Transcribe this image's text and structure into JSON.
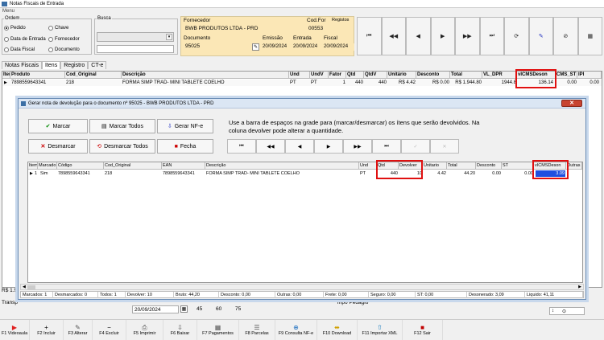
{
  "window": {
    "title": "Notas Fiscais de Entrada"
  },
  "menubar": {
    "label": "Menu"
  },
  "ordem": {
    "legend": "Ordem",
    "opts": [
      "Pedido",
      "Chave",
      "Data de Entrada",
      "Fornecedor",
      "Data Fiscal",
      "Documento"
    ],
    "selected": "Pedido"
  },
  "busca": {
    "legend": "Busca"
  },
  "fornecedor": {
    "label": "Fornecedor",
    "value": "BWB PRODUTOS LTDA - PRD",
    "cod_label": "Cod.For",
    "registros_label": "Registos",
    "cod_value": "00553",
    "doc_label": "Documento",
    "doc_value": "95025",
    "emissao_label": "Emissão",
    "emissao_value": "20/09/2024",
    "entrada_label": "Entrada",
    "entrada_value": "20/09/2024",
    "fiscal_label": "Fiscal",
    "fiscal_value": "20/09/2024"
  },
  "nav": [
    "⏮",
    "◀◀",
    "◀",
    "▶",
    "▶▶",
    "⏭",
    "⟳",
    "✎",
    "⊘",
    "▦"
  ],
  "tabs": [
    "Notas Fiscais",
    "Itens",
    "Registro",
    "CT-e"
  ],
  "main_grid": {
    "headers": [
      "Item",
      "Produto",
      "Cod_Original",
      "Descrição",
      "Und",
      "UndV",
      "Fator",
      "Qtd",
      "QtdV",
      "Unitário",
      "Desconto",
      "Total",
      "VL_DPR",
      "vICMSDeson",
      "CMS_ST",
      "IPI"
    ],
    "row": [
      "1",
      "7898559643341",
      "218",
      "FORMA SIMP TRAD- MINI TABLETE COELHO",
      "PT",
      "PT",
      "1",
      "440",
      "440",
      "R$ 4.42",
      "R$ 0.00",
      "R$ 1.944.80",
      "1944.8",
      "136.14",
      "0.00",
      "0.00"
    ]
  },
  "behind": {
    "rs_left": "R$ 1.9",
    "transp_label": "Transp",
    "date": "20/09/2024",
    "v45": "45",
    "v60": "60",
    "v75": "75",
    "cargo": "mpo Pedagio"
  },
  "dialog": {
    "title": "Gerar nota de devolução para o documento nº 95025 - BWB PRODUTOS LTDA - PRD",
    "btn_marcar": "Marcar",
    "btn_marcar_todos": "Marcar Todos",
    "btn_gerar": "Gerar NF-e",
    "btn_desmarcar": "Desmarcar",
    "btn_desmarcar_todos": "Desmarcar Todos",
    "btn_fecha": "Fecha",
    "hint": "Use a barra de espaços na grade para (marcar/desmarcar) os ítens que serão devolvidos. Na coluna devolver pode alterar a quantidade.",
    "nav": [
      "⏮",
      "◀◀",
      "◀",
      "▶",
      "▶▶",
      "⏭",
      "✓",
      "✕"
    ],
    "grid_headers": [
      "Item",
      "Marcado",
      "Código",
      "Cod_Original",
      "EAN",
      "Descrição",
      "Und",
      "Qtd",
      "Devolver",
      "Unitario",
      "Total",
      "Desconto",
      "ST",
      "vICMSDeson",
      "Outras"
    ],
    "grid_row": [
      "1",
      "Sim",
      "7898559643341",
      "218",
      "7898559643341",
      "FORMA SIMP TRAD- MINI TABLETE COELHO",
      "PT",
      "440",
      "10",
      "4.42",
      "44.20",
      "0.00",
      "0.00",
      "3.09",
      ""
    ],
    "summary": [
      "Marcados: 1",
      "Desmarcados: 0",
      "Todos: 1",
      "Devolver: 10",
      "Bruto: 44,20",
      "Desconto: 0,00",
      "Outras: 0,00",
      "Frete: 0,00",
      "Seguro: 0,00",
      "ST: 0,00",
      "Desonerado: 3,09",
      "Liquido: 41,11"
    ]
  },
  "fkeys": [
    {
      "g": "▶",
      "c": "#e02020",
      "label": "F1 Videoaula"
    },
    {
      "g": "+",
      "c": "#000",
      "label": "F2 Incluir"
    },
    {
      "g": "✎",
      "c": "#555",
      "label": "F3 Alterar"
    },
    {
      "g": "−",
      "c": "#000",
      "label": "F4 Excluir"
    },
    {
      "g": "⎙",
      "c": "#555",
      "label": "F5 Imprimir"
    },
    {
      "g": "⇩",
      "c": "#555",
      "label": "F6 Baixar"
    },
    {
      "g": "▦",
      "c": "#555",
      "label": "F7 Pagamentos"
    },
    {
      "g": "☰",
      "c": "#555",
      "label": "F8 Parcelas"
    },
    {
      "g": "⊕",
      "c": "#2070c0",
      "label": "F9 Consulta NF-e"
    },
    {
      "g": "⬌",
      "c": "#d0a000",
      "label": "F10 Download"
    },
    {
      "g": "⇧",
      "c": "#2080c0",
      "label": "F11 Importar XML"
    },
    {
      "g": "■",
      "c": "#c00000",
      "label": "F12 Sair"
    }
  ]
}
